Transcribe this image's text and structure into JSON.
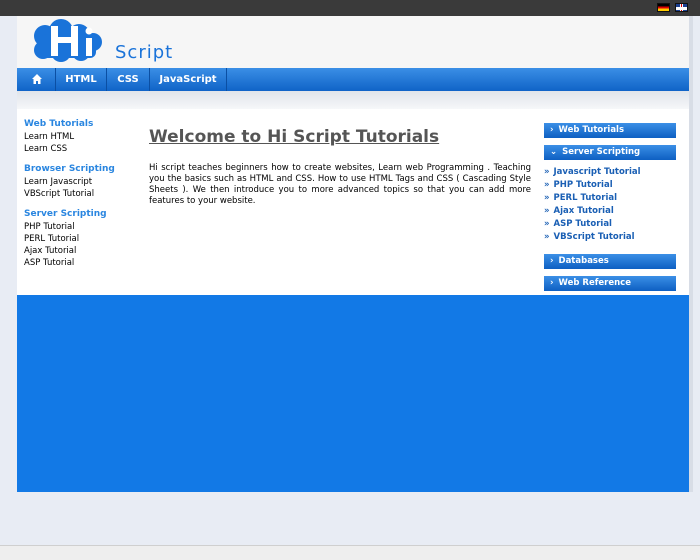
{
  "flags": {
    "german": "flag-de-icon",
    "english": "flag-uk-icon"
  },
  "logo": {
    "letters": "Hi",
    "text": "Script"
  },
  "nav": {
    "items": [
      {
        "label": "HTML"
      },
      {
        "label": "CSS"
      },
      {
        "label": "JavaScript"
      }
    ]
  },
  "left": {
    "groups": [
      {
        "title": "Web Tutorials",
        "items": [
          "Learn HTML",
          "Learn CSS"
        ]
      },
      {
        "title": "Browser Scripting",
        "items": [
          "Learn Javascript",
          "VBScript Tutorial"
        ]
      },
      {
        "title": "Server Scripting",
        "items": [
          "PHP Tutorial",
          "PERL Tutorial",
          "Ajax Tutorial",
          "ASP Tutorial"
        ]
      }
    ]
  },
  "main": {
    "title": "Welcome to Hi Script Tutorials",
    "text": "Hi script teaches beginners how to create websites, Learn web Programming . Teaching you the basics such as HTML and CSS. How to use HTML Tags and CSS ( Cascading Style Sheets ). We then introduce you to more advanced topics so that you can add more features to your website."
  },
  "right": {
    "web_tutorials": "Web Tutorials",
    "server_scripting": "Server Scripting",
    "server_items": [
      "Javascript Tutorial",
      "PHP Tutorial",
      "PERL Tutorial",
      "Ajax Tutorial",
      "ASP Tutorial",
      "VBScript Tutorial"
    ],
    "databases": "Databases",
    "web_reference": "Web Reference"
  },
  "colors": {
    "brand_blue": "#1279e6",
    "link_blue": "#2a86e0"
  }
}
